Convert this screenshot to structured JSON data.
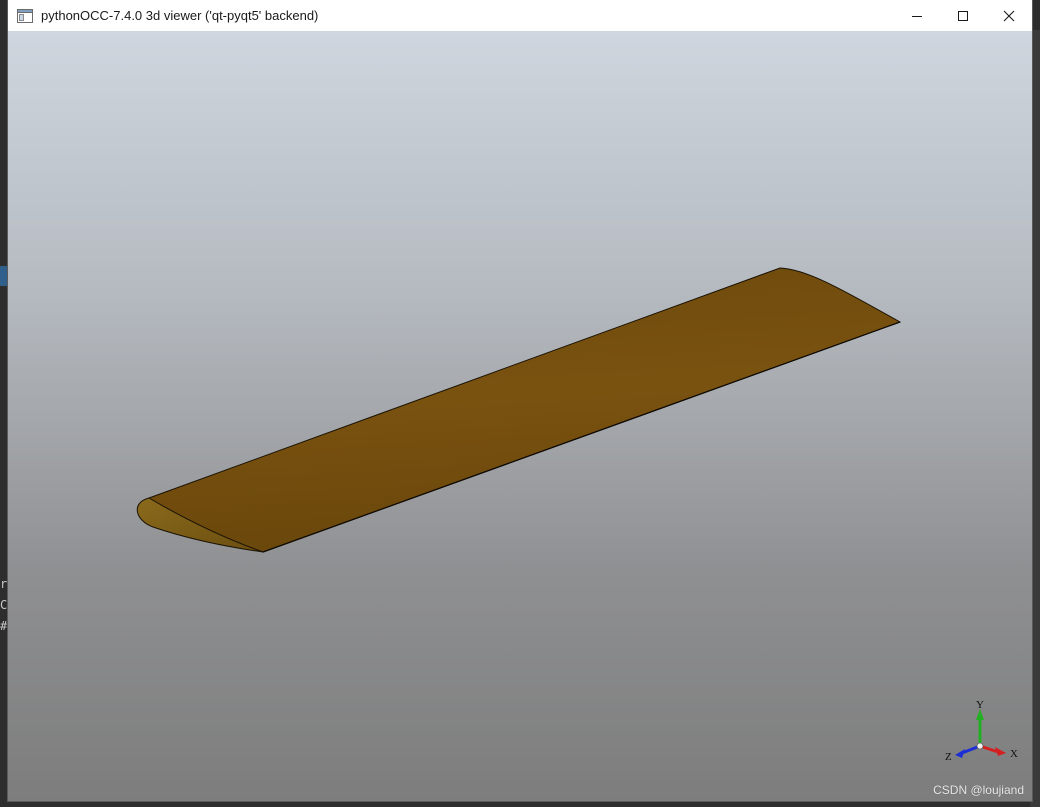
{
  "window": {
    "title": "pythonOCC-7.4.0 3d viewer ('qt-pyqt5' backend)",
    "controls": {
      "minimize_icon": "minimize-icon",
      "maximize_icon": "maximize-icon",
      "close_icon": "close-icon"
    }
  },
  "viewer": {
    "background_top": "#cfd6df",
    "background_bottom": "#7d7d7d",
    "model_color": "#7a5210",
    "model_name": "wing-airfoil-extrusion",
    "triad": {
      "x_label": "X",
      "y_label": "Y",
      "z_label": "Z",
      "x_color": "#d42020",
      "y_color": "#22b022",
      "z_color": "#1c2fd6"
    }
  },
  "desktop_fragments": {
    "line1": "r|",
    "line2": "C(",
    "line3": "#"
  },
  "watermark": "CSDN @loujiand"
}
